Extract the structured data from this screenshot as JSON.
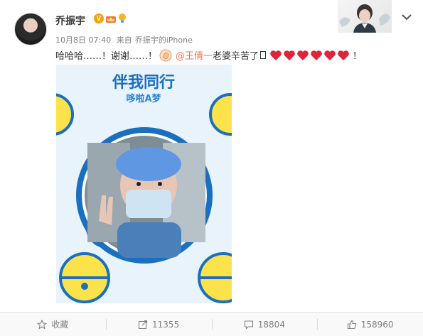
{
  "post": {
    "username": "乔振宇",
    "time": "10月8日 07:40",
    "source_prefix": "来自",
    "source": "乔振宇的iPhone",
    "text_start": "哈哈哈……！谢谢……！",
    "mention": "@王倩一",
    "text_after_mention": " 老婆辛苦了",
    "text_end": "！"
  },
  "image": {
    "title": "伴我同行",
    "subtitle": "哆啦A梦"
  },
  "actions": {
    "favorite_label": "收藏",
    "repost_count": "11355",
    "comment_count": "18804",
    "like_count": "158960"
  },
  "icons": {
    "verified": "verified-v-icon",
    "dropdown": "chevron-down-icon",
    "repost": "repost-icon",
    "comment": "comment-icon",
    "like": "like-icon",
    "favorite": "star-icon"
  },
  "colors": {
    "mention": "#eb7350",
    "heart": "#e0243a",
    "badge": "#f7a400"
  }
}
